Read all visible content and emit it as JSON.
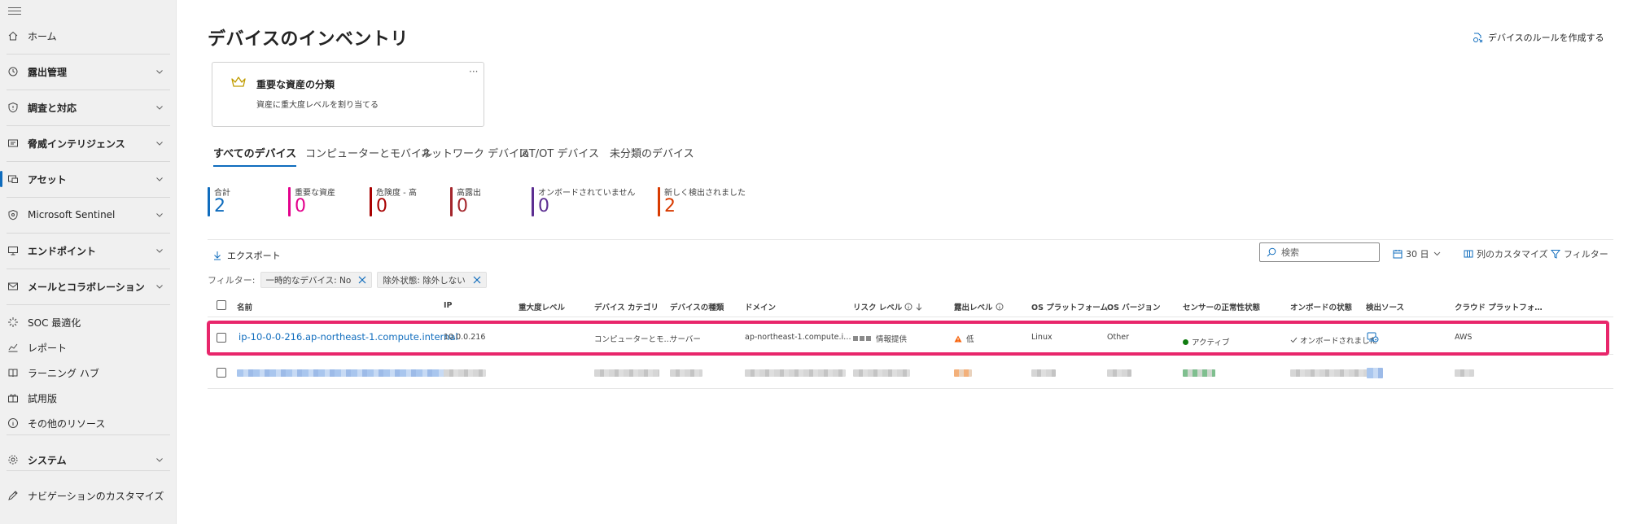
{
  "sidebar": {
    "items": [
      {
        "label": "ホーム",
        "icon": "home-icon",
        "bold": false,
        "expandable": false
      },
      {
        "label": "露出管理",
        "icon": "exposure-icon",
        "bold": true,
        "expandable": true
      },
      {
        "label": "調査と対応",
        "icon": "shield-icon",
        "bold": true,
        "expandable": true
      },
      {
        "label": "脅威インテリジェンス",
        "icon": "threat-intel-icon",
        "bold": true,
        "expandable": true
      },
      {
        "label": "アセット",
        "icon": "assets-icon",
        "bold": true,
        "expandable": true,
        "active": true
      },
      {
        "label": "Microsoft Sentinel",
        "icon": "sentinel-icon",
        "bold": false,
        "expandable": true
      },
      {
        "label": "エンドポイント",
        "icon": "endpoint-icon",
        "bold": true,
        "expandable": true
      },
      {
        "label": "メールとコラボレーション",
        "icon": "mail-icon",
        "bold": true,
        "expandable": true
      },
      {
        "label": "SOC 最適化",
        "icon": "soc-optimization-icon",
        "bold": false,
        "expandable": false
      },
      {
        "label": "レポート",
        "icon": "reports-icon",
        "bold": false,
        "expandable": false
      },
      {
        "label": "ラーニング ハブ",
        "icon": "learning-hub-icon",
        "bold": false,
        "expandable": false
      },
      {
        "label": "試用版",
        "icon": "trial-icon",
        "bold": false,
        "expandable": false
      },
      {
        "label": "その他のリソース",
        "icon": "info-icon",
        "bold": false,
        "expandable": false
      },
      {
        "label": "システム",
        "icon": "gear-icon",
        "bold": true,
        "expandable": true
      },
      {
        "label": "ナビゲーションのカスタマイズ",
        "icon": "pencil-icon",
        "bold": false,
        "expandable": false
      }
    ]
  },
  "header": {
    "title": "デバイスのインベントリ",
    "create_rule": "デバイスのルールを作成する"
  },
  "asset_card": {
    "title": "重要な資産の分類",
    "description": "資産に重大度レベルを割り当てる",
    "more": "···"
  },
  "tabs": [
    "すべてのデバイス",
    "コンピューターとモバイル",
    "ネットワーク デバイス",
    "IoT/OT デバイス",
    "未分類のデバイス"
  ],
  "stats": [
    {
      "label": "合計",
      "value": "2",
      "color": "#0f6cbd"
    },
    {
      "label": "重要な資産",
      "value": "0",
      "color": "#e3008c"
    },
    {
      "label": "危険度 - 高",
      "value": "0",
      "color": "#a80000"
    },
    {
      "label": "高露出",
      "value": "0",
      "color": "#a4262c"
    },
    {
      "label": "オンボードされていません",
      "value": "0",
      "color": "#5c2e91"
    },
    {
      "label": "新しく検出されました",
      "value": "2",
      "color": "#d83b01"
    }
  ],
  "toolbar": {
    "export": "エクスポート",
    "search_placeholder": "検索",
    "days": "30 日",
    "customize_columns": "列のカスタマイズ",
    "filter": "フィルター"
  },
  "filters": {
    "label": "フィルター:",
    "chips": [
      "一時的なデバイス: No",
      "除外状態: 除外しない"
    ]
  },
  "table": {
    "columns": [
      "名前",
      "IP",
      "重大度レベル",
      "デバイス カテゴリ",
      "デバイスの種類",
      "ドメイン",
      "リスク レベル",
      "露出レベル",
      "OS プラットフォーム",
      "OS バージョン",
      "センサーの正常性状態",
      "オンボードの状態",
      "検出ソース",
      "クラウド プラットフォ…"
    ],
    "rows": [
      {
        "name": "ip-10-0-0-216.ap-northeast-1.compute.internal",
        "ip": "10.0.0.216",
        "severity": "",
        "category": "コンピューターとモ…",
        "type": "サーバー",
        "domain": "ap-northeast-1.compute.i…",
        "risk": "情報提供",
        "exposure": "低",
        "os_platform": "Linux",
        "os_version": "Other",
        "sensor_health": "アクティブ",
        "onboarding": "オンボードされました",
        "cloud": "AWS"
      }
    ]
  },
  "colors": {
    "accent": "#0f6cbd",
    "highlight": "#e8266b",
    "active_green": "#107c10",
    "warning_orange": "#f7630c"
  }
}
